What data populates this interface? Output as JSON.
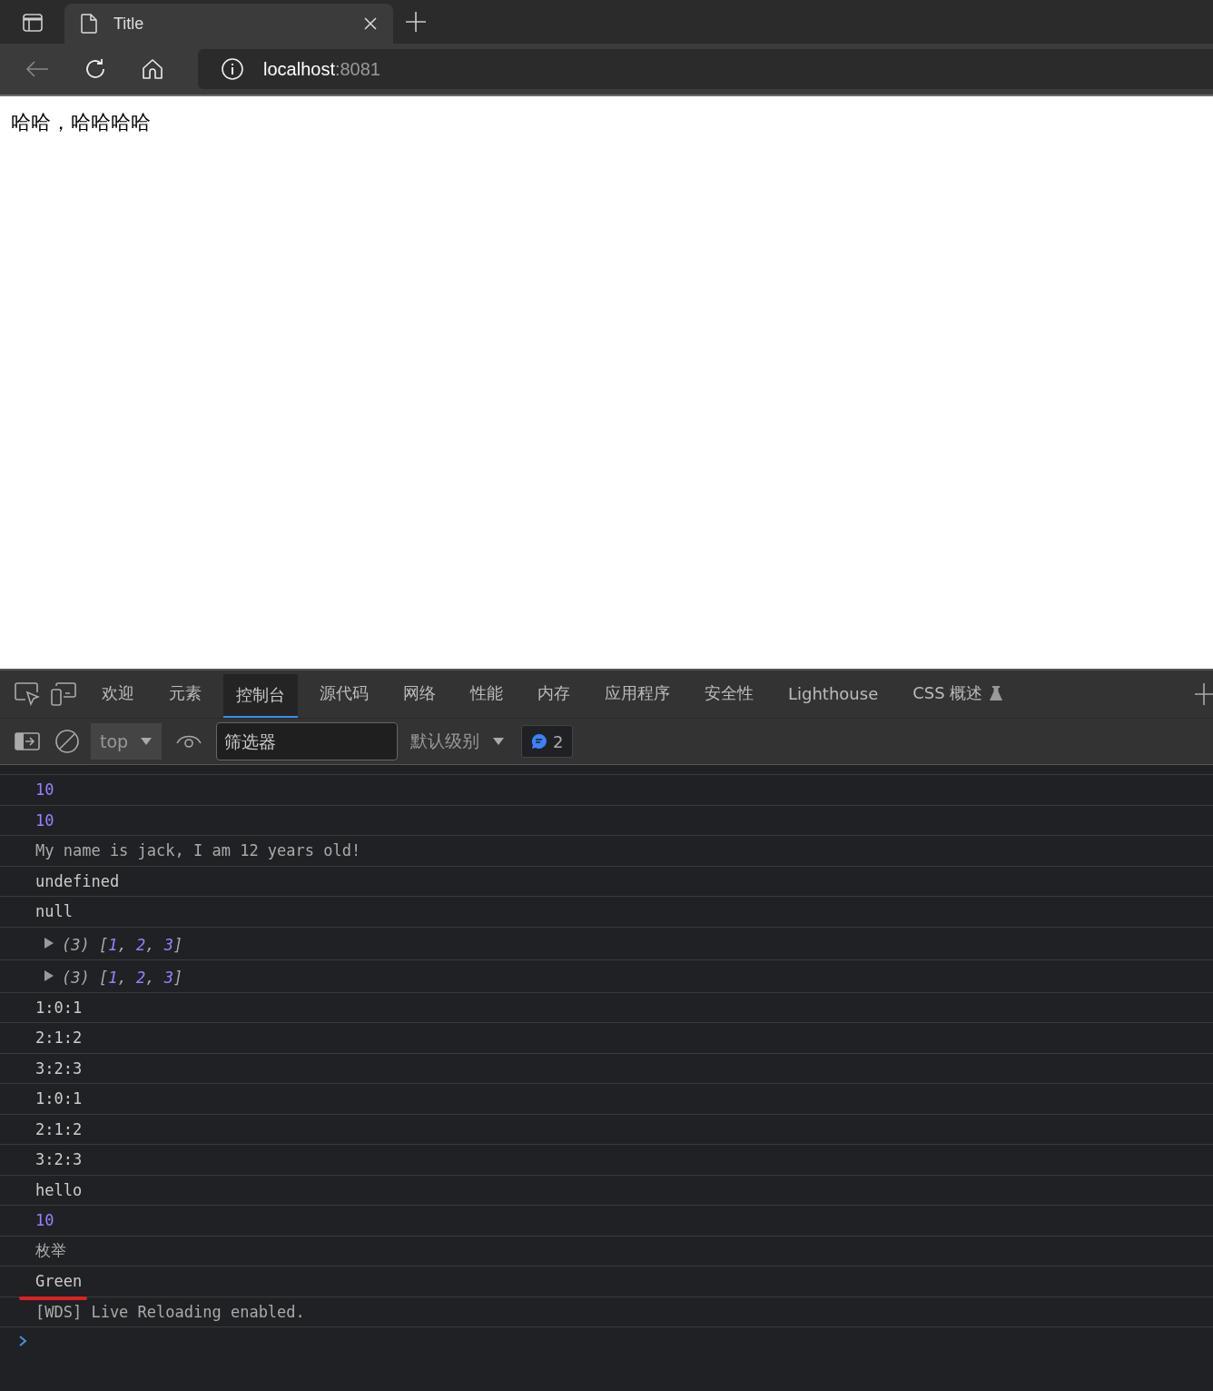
{
  "browser": {
    "tab": {
      "title": "Title"
    },
    "address": {
      "host": "localhost",
      "port": ":8081"
    }
  },
  "page": {
    "text": "哈哈，哈哈哈哈"
  },
  "devtools": {
    "tabs": [
      {
        "label": "欢迎",
        "selected": false
      },
      {
        "label": "元素",
        "selected": false
      },
      {
        "label": "控制台",
        "selected": true
      },
      {
        "label": "源代码",
        "selected": false
      },
      {
        "label": "网络",
        "selected": false
      },
      {
        "label": "性能",
        "selected": false
      },
      {
        "label": "内存",
        "selected": false
      },
      {
        "label": "应用程序",
        "selected": false
      },
      {
        "label": "安全性",
        "selected": false
      },
      {
        "label": "Lighthouse",
        "selected": false
      },
      {
        "label": "CSS 概述",
        "selected": false,
        "experimental": true
      }
    ],
    "toolbar": {
      "context": "top",
      "filter": {
        "placeholder": "筛选器"
      },
      "level": "默认级别",
      "messages": "2"
    },
    "console": [
      {
        "kind": "number",
        "text": "10"
      },
      {
        "kind": "number",
        "text": "10"
      },
      {
        "kind": "string",
        "text": "My name is jack, I am 12 years old!"
      },
      {
        "kind": "text",
        "text": "undefined"
      },
      {
        "kind": "text",
        "text": "null"
      },
      {
        "kind": "array",
        "parts": [
          {
            "kind": "punct",
            "text": "(3) ["
          },
          {
            "kind": "number",
            "text": "1"
          },
          {
            "kind": "punct",
            "text": ", "
          },
          {
            "kind": "number",
            "text": "2"
          },
          {
            "kind": "punct",
            "text": ", "
          },
          {
            "kind": "number",
            "text": "3"
          },
          {
            "kind": "punct",
            "text": "]"
          }
        ],
        "expanded": false
      },
      {
        "kind": "array",
        "parts": [
          {
            "kind": "punct",
            "text": "(3) ["
          },
          {
            "kind": "number",
            "text": "1"
          },
          {
            "kind": "punct",
            "text": ", "
          },
          {
            "kind": "number",
            "text": "2"
          },
          {
            "kind": "punct",
            "text": ", "
          },
          {
            "kind": "number",
            "text": "3"
          },
          {
            "kind": "punct",
            "text": "]"
          }
        ],
        "expanded": false
      },
      {
        "kind": "text",
        "text": "1:0:1"
      },
      {
        "kind": "text",
        "text": "2:1:2"
      },
      {
        "kind": "text",
        "text": "3:2:3"
      },
      {
        "kind": "text",
        "text": "1:0:1"
      },
      {
        "kind": "text",
        "text": "2:1:2"
      },
      {
        "kind": "text",
        "text": "3:2:3"
      },
      {
        "kind": "text",
        "text": "hello"
      },
      {
        "kind": "number",
        "text": "10"
      },
      {
        "kind": "string",
        "text": "枚举"
      },
      {
        "kind": "text",
        "text": "Green",
        "underlined": true
      },
      {
        "kind": "string",
        "text": "[WDS] Live Reloading enabled."
      }
    ]
  }
}
